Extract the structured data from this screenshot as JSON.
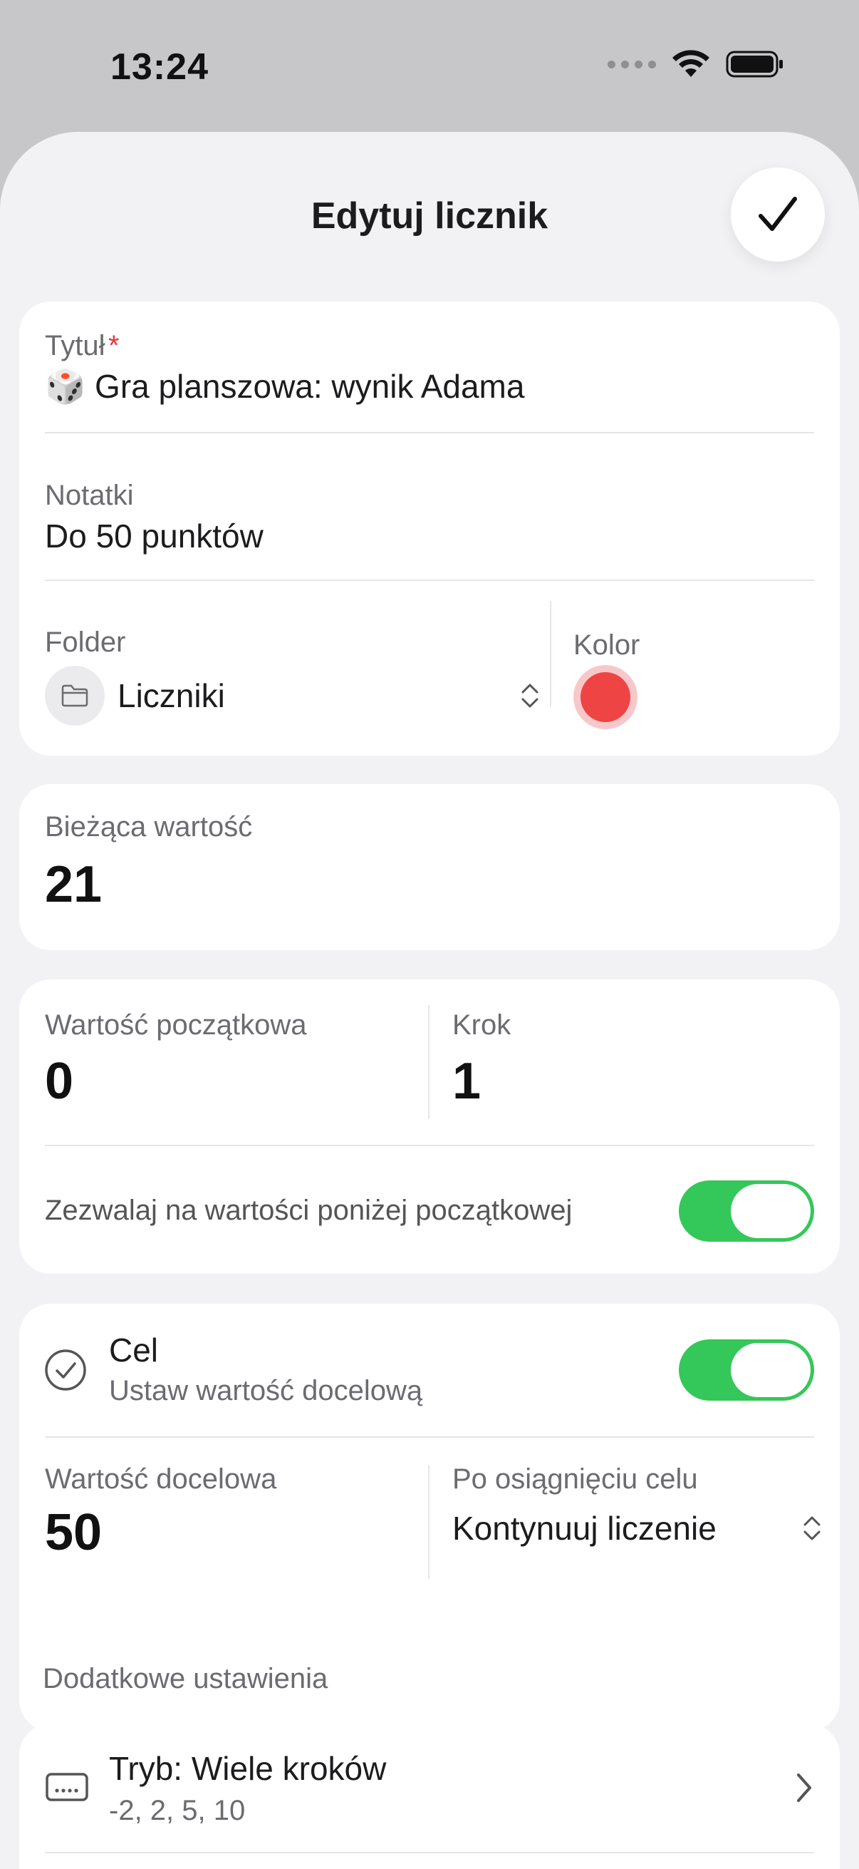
{
  "status": {
    "time": "13:24"
  },
  "nav": {
    "title": "Edytuj licznik"
  },
  "details": {
    "title_label": "Tytuł",
    "required_mark": "*",
    "title_value": "🎲 Gra planszowa: wynik Adama",
    "notes_label": "Notatki",
    "notes_value": "Do 50 punktów",
    "folder_label": "Folder",
    "folder_value": "Liczniki",
    "color_label": "Kolor",
    "color_value": "#ef4444"
  },
  "current": {
    "label": "Bieżąca wartość",
    "value": "21"
  },
  "values": {
    "start_label": "Wartość początkowa",
    "start_value": "0",
    "step_label": "Krok",
    "step_value": "1",
    "allow_below_label": "Zezwalaj na wartości poniżej początkowej",
    "allow_below_on": true
  },
  "goal": {
    "title": "Cel",
    "subtitle": "Ustaw wartość docelową",
    "enabled": true,
    "target_label": "Wartość docelowa",
    "target_value": "50",
    "after_label": "Po osiągnięciu celu",
    "after_value": "Kontynuuj liczenie"
  },
  "extra": {
    "header": "Dodatkowe ustawienia",
    "mode_title": "Tryb: Wiele kroków",
    "mode_subtitle": "-2, 2, 5, 10"
  },
  "colors": {
    "accent_green": "#34c759",
    "counter_red": "#ef4444"
  }
}
